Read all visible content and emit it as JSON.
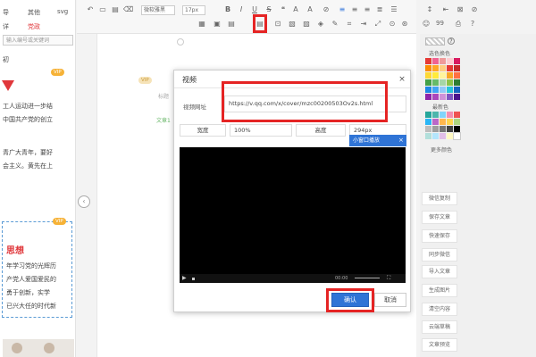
{
  "left_panel": {
    "tabs_row1": [
      "导",
      "其他",
      "svg"
    ],
    "tabs_row2": [
      "详",
      "党政"
    ],
    "search_placeholder": "输入编号或关键词",
    "card1_label": "初",
    "vip": "VIP",
    "card1_lines": [
      "工人运动进一步结",
      "中国共产党的创立",
      "青广大青年，要好",
      "会主义。黄先在上"
    ],
    "card2_heading": "思想",
    "card2_lines": [
      "年学习党的光辉历",
      "产党人爱国爱民的",
      "勇于创新，实学",
      "已兴大任的时代新"
    ]
  },
  "toolbar": {
    "font_family": "微软雅黑",
    "font_size": "17px",
    "bold": "B",
    "italic": "I",
    "underline": "U",
    "strike": "S",
    "font_a": "A",
    "highlight_letter": "A",
    "line_height_label": "99"
  },
  "canvas": {
    "side_label_1": "标题",
    "side_label_2": "文章1"
  },
  "dialog": {
    "title": "视频",
    "url_label": "视频网址",
    "url_value": "https://v.qq.com/x/cover/mzc00200503Ov2s.html",
    "width_label": "宽度",
    "width_value": "100%",
    "height_label": "高度",
    "height_value": "294px",
    "pip_label": "小窗口播放",
    "time": "00:00",
    "confirm": "确认",
    "cancel": "取消"
  },
  "right_panel": {
    "theme_label": "选色换色",
    "recent_label": "最新色",
    "more_colors": "更多颜色",
    "buttons": [
      "微信复制",
      "保存文章",
      "快速保存",
      "同步微信",
      "导入文章",
      "生成图片",
      "清空内容",
      "云端草稿",
      "文章预览"
    ],
    "colors_row": [
      "#e53935",
      "#f06292",
      "#ef9a9a",
      "#ffcdd2",
      "#d81b60",
      "#c2185b"
    ]
  }
}
